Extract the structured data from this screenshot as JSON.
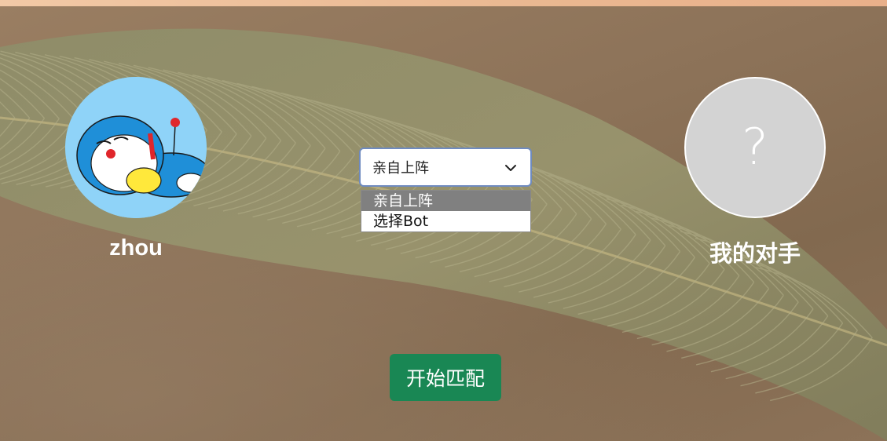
{
  "players": {
    "me": {
      "name": "zhou",
      "avatar_icon": "doraemon-sleeping-avatar"
    },
    "opponent": {
      "name": "我的对手",
      "avatar_placeholder": "?"
    }
  },
  "mode_select": {
    "selected": "亲自上阵",
    "options": [
      "亲自上阵",
      "选择Bot"
    ],
    "chevron_icon": "chevron-down-icon"
  },
  "actions": {
    "start_match_label": "开始匹配"
  },
  "colors": {
    "primary_button": "#198754",
    "select_border": "#6f8bc0",
    "selected_option_bg": "#808080",
    "avatar_bg": "#8fd3f8",
    "unknown_avatar_bg": "#d3d3d3"
  }
}
